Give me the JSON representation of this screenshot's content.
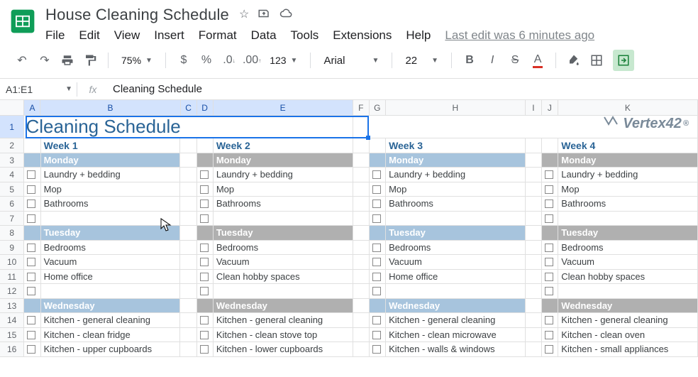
{
  "doc": {
    "title": "House Cleaning Schedule"
  },
  "menu": {
    "file": "File",
    "edit": "Edit",
    "view": "View",
    "insert": "Insert",
    "format": "Format",
    "data": "Data",
    "tools": "Tools",
    "extensions": "Extensions",
    "help": "Help",
    "lastedit": "Last edit was 6 minutes ago"
  },
  "toolbar": {
    "zoom": "75%",
    "font": "Arial",
    "size": "22",
    "fmt123": "123"
  },
  "namebox": {
    "ref": "A1:E1",
    "formula": "Cleaning Schedule"
  },
  "cols": [
    "A",
    "B",
    "C",
    "D",
    "E",
    "F",
    "G",
    "H",
    "I",
    "J",
    "K"
  ],
  "sheet": {
    "title": "Cleaning Schedule",
    "vertex": "Vertex42",
    "weeks": [
      {
        "label": "Week 1",
        "days": [
          {
            "name": "Monday",
            "gray": false,
            "tasks": [
              "Laundry + bedding",
              "Mop",
              "Bathrooms",
              ""
            ]
          },
          {
            "name": "Tuesday",
            "gray": false,
            "tasks": [
              "Bedrooms",
              "Vacuum",
              "Home office",
              ""
            ]
          },
          {
            "name": "Wednesday",
            "gray": false,
            "tasks": [
              "Kitchen - general cleaning",
              "Kitchen - clean fridge",
              "Kitchen - upper cupboards"
            ]
          }
        ]
      },
      {
        "label": "Week 2",
        "days": [
          {
            "name": "Monday",
            "gray": true,
            "tasks": [
              "Laundry + bedding",
              "Mop",
              "Bathrooms",
              ""
            ]
          },
          {
            "name": "Tuesday",
            "gray": true,
            "tasks": [
              "Bedrooms",
              "Vacuum",
              "Clean hobby spaces",
              ""
            ]
          },
          {
            "name": "Wednesday",
            "gray": true,
            "tasks": [
              "Kitchen - general cleaning",
              "Kitchen - clean stove top",
              "Kitchen - lower cupboards"
            ]
          }
        ]
      },
      {
        "label": "Week 3",
        "days": [
          {
            "name": "Monday",
            "gray": false,
            "tasks": [
              "Laundry + bedding",
              "Mop",
              "Bathrooms",
              ""
            ]
          },
          {
            "name": "Tuesday",
            "gray": false,
            "tasks": [
              "Bedrooms",
              "Vacuum",
              "Home office",
              ""
            ]
          },
          {
            "name": "Wednesday",
            "gray": false,
            "tasks": [
              "Kitchen - general cleaning",
              "Kitchen - clean microwave",
              "Kitchen - walls & windows"
            ]
          }
        ]
      },
      {
        "label": "Week 4",
        "days": [
          {
            "name": "Monday",
            "gray": true,
            "tasks": [
              "Laundry + bedding",
              "Mop",
              "Bathrooms",
              ""
            ]
          },
          {
            "name": "Tuesday",
            "gray": true,
            "tasks": [
              "Bedrooms",
              "Vacuum",
              "Clean hobby spaces",
              ""
            ]
          },
          {
            "name": "Wednesday",
            "gray": true,
            "tasks": [
              "Kitchen - general cleaning",
              "Kitchen - clean oven",
              "Kitchen - small appliances"
            ]
          }
        ]
      }
    ]
  }
}
